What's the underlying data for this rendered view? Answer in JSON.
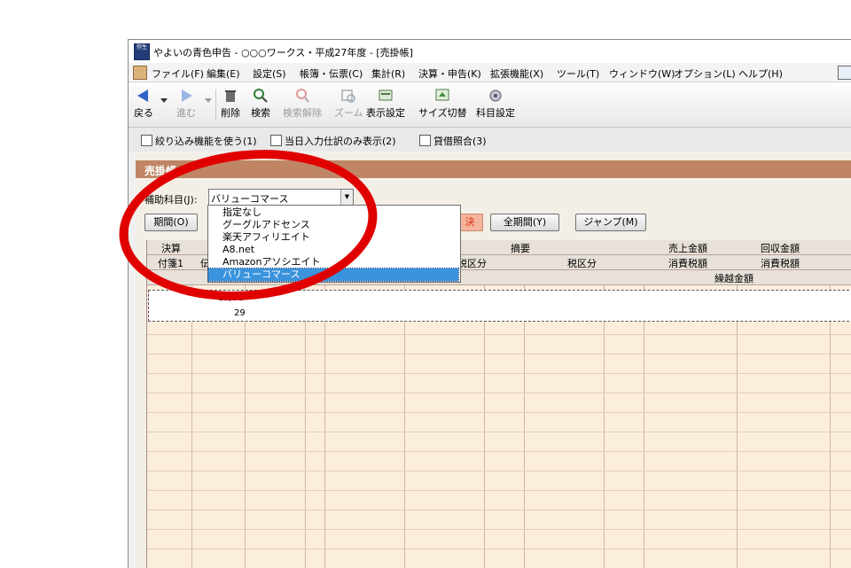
{
  "window": {
    "title": "やよいの青色申告 - ○○○ワークス・平成27年度 - [売掛帳]",
    "app_icon_label": "弥生"
  },
  "menu": {
    "items": [
      "ファイル(F)",
      "編集(E)",
      "設定(S)",
      "帳簿・伝票(C)",
      "集計(R)",
      "決算・申告(K)",
      "拡張機能(X)",
      "ツール(T)",
      "ウィンドウ(W)",
      "オプション(L)",
      "ヘルプ(H)"
    ]
  },
  "toolbar": {
    "back": "戻る",
    "forward": "進む",
    "delete": "削除",
    "search": "検索",
    "search_clear": "検索解除",
    "zoom": "ズーム",
    "display_settings": "表示設定",
    "size_toggle": "サイズ切替",
    "account_settings": "科目設定"
  },
  "filterbar": {
    "filter_label": "絞り込み機能を使う(1)",
    "today_only_label": "当日入力仕訳のみ表示(2)",
    "reconcile_label": "貸借照合(3)"
  },
  "panel": {
    "title": "売掛帳",
    "sub_account_label": "補助科目(J):",
    "sub_account_value": "バリューコマース",
    "period_button": "期間(O)",
    "kessan_button": "決",
    "all_period_button": "全期間(Y)",
    "jump_button": "ジャンプ(M)"
  },
  "dropdown": {
    "options": [
      "指定なし",
      "グーグルアドセンス",
      "楽天アフィリエイト",
      "A8.net",
      "Amazonアソシエイト",
      "バリューコマース"
    ],
    "selected_index": 5
  },
  "grid": {
    "header_row1": {
      "kessan": "決算",
      "tekiyo": "摘要",
      "uriage": "売上金額",
      "kaishu": "回収金額"
    },
    "header_row2": {
      "fusen": "付箋1",
      "den": "伝",
      "zeiku1": "税区分",
      "zeiku2": "税区分",
      "tax1": "消費税額",
      "tax2": "消費税額"
    },
    "header_row3": {
      "kurikoshi": "繰越金額"
    },
    "row1": {
      "date": "12/31",
      "day": "29"
    }
  },
  "colors": {
    "panel_header": "#bf8565",
    "annotation_red": "#e00000",
    "grid_bg": "#fbeedd",
    "selected_option": "#3a93dc"
  }
}
